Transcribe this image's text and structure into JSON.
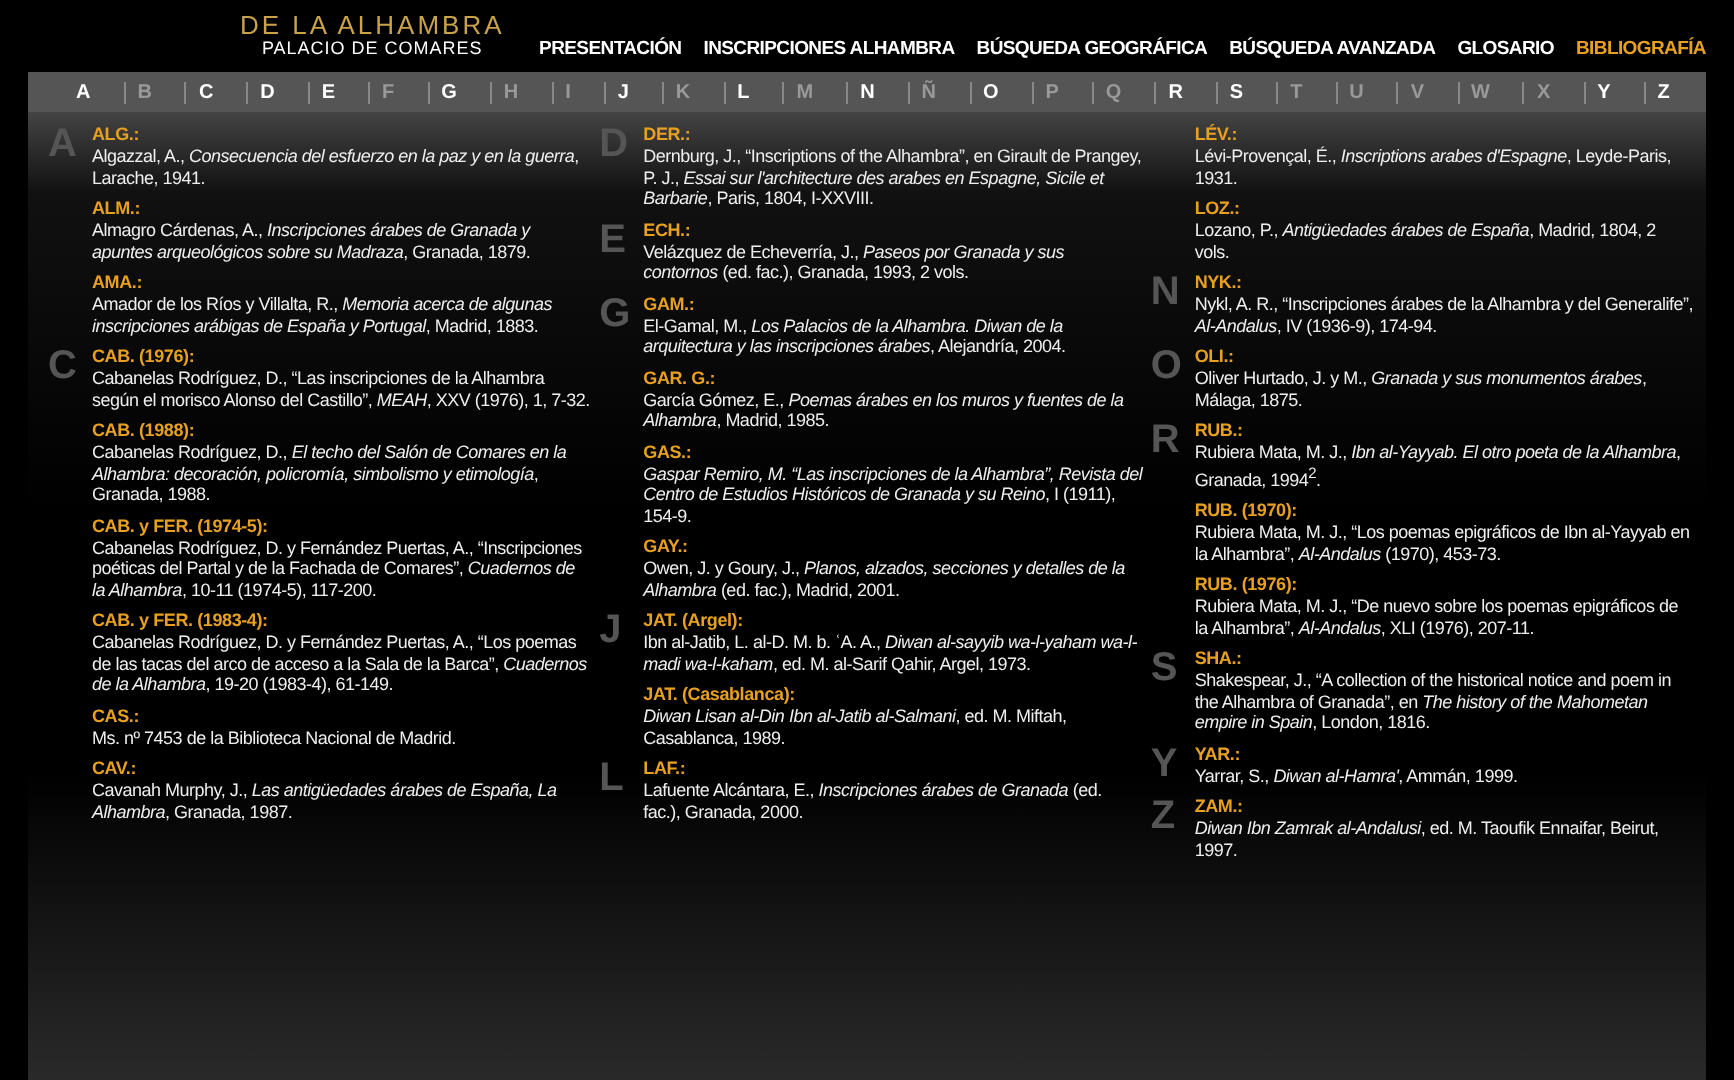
{
  "header": {
    "logo_title": "DE LA ALHAMBRA",
    "logo_subtitle": "PALACIO DE COMARES"
  },
  "nav": [
    {
      "label": "PRESENTACIÓN",
      "selected": false
    },
    {
      "label": "INSCRIPCIONES ALHAMBRA",
      "selected": false
    },
    {
      "label": "BÚSQUEDA GEOGRÁFICA",
      "selected": false
    },
    {
      "label": "BÚSQUEDA AVANZADA",
      "selected": false
    },
    {
      "label": "GLOSARIO",
      "selected": false
    },
    {
      "label": "BIBLIOGRAFÍA",
      "selected": true
    }
  ],
  "alphabet": [
    {
      "letter": "A",
      "enabled": true
    },
    {
      "letter": "B",
      "enabled": false
    },
    {
      "letter": "C",
      "enabled": true
    },
    {
      "letter": "D",
      "enabled": true
    },
    {
      "letter": "E",
      "enabled": true
    },
    {
      "letter": "F",
      "enabled": false
    },
    {
      "letter": "G",
      "enabled": true
    },
    {
      "letter": "H",
      "enabled": false
    },
    {
      "letter": "I",
      "enabled": false
    },
    {
      "letter": "J",
      "enabled": true
    },
    {
      "letter": "K",
      "enabled": false
    },
    {
      "letter": "L",
      "enabled": true
    },
    {
      "letter": "M",
      "enabled": false
    },
    {
      "letter": "N",
      "enabled": true
    },
    {
      "letter": "Ñ",
      "enabled": false
    },
    {
      "letter": "O",
      "enabled": true
    },
    {
      "letter": "P",
      "enabled": false
    },
    {
      "letter": "Q",
      "enabled": false
    },
    {
      "letter": "R",
      "enabled": true
    },
    {
      "letter": "S",
      "enabled": true
    },
    {
      "letter": "T",
      "enabled": false
    },
    {
      "letter": "U",
      "enabled": false
    },
    {
      "letter": "V",
      "enabled": false
    },
    {
      "letter": "W",
      "enabled": false
    },
    {
      "letter": "X",
      "enabled": false
    },
    {
      "letter": "Y",
      "enabled": true
    },
    {
      "letter": "Z",
      "enabled": true
    }
  ],
  "columns": [
    [
      {
        "section": "A",
        "key": "ALG.:",
        "text": "Algazzal, A., *Consecuencia del esfuerzo en la paz y en la guerra*, Larache, 1941."
      },
      {
        "key": "ALM.:",
        "text": "Almagro Cárdenas, A., *Inscripciones árabes de Granada y apuntes arqueológicos sobre su Madraza*, Granada, 1879."
      },
      {
        "key": "AMA.:",
        "text": "Amador de los Ríos y Villalta, R., *Memoria acerca de algunas inscripciones arábigas de España y Portugal*, Madrid, 1883."
      },
      {
        "section": "C",
        "key": "CAB. (1976):",
        "text": "Cabanelas Rodríguez, D., “Las inscripciones de la Alhambra según el morisco Alonso del Castillo”, *MEAH*, XXV (1976), 1, 7-32."
      },
      {
        "key": "CAB. (1988):",
        "text": "Cabanelas Rodríguez, D., *El techo del Salón de Comares en la Alhambra: decoración, policromía, simbolismo y etimología*, Granada, 1988."
      },
      {
        "key": "CAB. y FER. (1974-5):",
        "text": "Cabanelas Rodríguez, D. y Fernández Puertas, A., “Inscripciones poéticas del Partal y de la Fachada de Comares”, *Cuadernos de la Alhambra*, 10-11 (1974-5), 117-200."
      },
      {
        "key": "CAB. y FER. (1983-4):",
        "text": "Cabanelas Rodríguez, D. y Fernández Puertas, A., “Los poemas de las tacas del arco de acceso a la Sala de la Barca”, *Cuadernos de la Alhambra*, 19-20 (1983-4), 61-149."
      },
      {
        "key": "CAS.:",
        "text": "Ms. nº 7453 de la Biblioteca Nacional de Madrid."
      },
      {
        "key": "CAV.:",
        "text": "Cavanah Murphy, J., *Las antigüedades árabes de España, La Alhambra*, Granada, 1987."
      }
    ],
    [
      {
        "section": "D",
        "key": "DER.:",
        "text": "Dernburg, J., “Inscriptions of the Alhambra”, en Girault de Prangey, P. J., *Essai sur l'architecture des arabes en Espagne, Sicile et Barbarie*, Paris, 1804, I-XXVIII."
      },
      {
        "section": "E",
        "key": "ECH.:",
        "text": "Velázquez de Echeverría, J., *Paseos por Granada y sus contornos* (ed. fac.), Granada, 1993, 2 vols."
      },
      {
        "section": "G",
        "key": "GAM.:",
        "text": "El-Gamal, M., *Los Palacios de la Alhambra. Diwan de la arquitectura y las inscripciones árabes*, Alejandría, 2004."
      },
      {
        "key": "GAR. G.:",
        "text": "García Gómez, E., *Poemas árabes en los muros y fuentes de la Alhambra*, Madrid, 1985."
      },
      {
        "key": "GAS.:",
        "text": "*Gaspar Remiro, M. “Las inscripciones de la Alhambra”, Revista del Centro de Estudios Históricos de Granada y su Reino*, I (1911), 154-9."
      },
      {
        "key": "GAY.:",
        "text": "Owen, J. y Goury, J., *Planos, alzados, secciones y detalles de la Alhambra* (ed. fac.), Madrid, 2001."
      },
      {
        "section": "J",
        "key": "JAT. (Argel):",
        "text": "Ibn al-Jatib, L. al-D. M. b. ʿA. A., *Diwan al-sayyib wa-l-yaham wa-l-madi wa-l-kaham*, ed. M. al-Sarif Qahir, Argel, 1973."
      },
      {
        "key": "JAT. (Casablanca):",
        "text": "*Diwan Lisan al-Din Ibn al-Jatib al-Salmani*, ed. M. Miftah, Casablanca, 1989."
      },
      {
        "section": "L",
        "key": "LAF.:",
        "text": "Lafuente Alcántara, E., *Inscripciones árabes de Granada* (ed. fac.), Granada, 2000."
      }
    ],
    [
      {
        "key": "LÉV.:",
        "text": "Lévi-Provençal, É., *Inscriptions arabes d'Espagne*, Leyde-Paris, 1931."
      },
      {
        "key": "LOZ.:",
        "text": "Lozano, P., *Antigüedades árabes de España*, Madrid, 1804, 2 vols."
      },
      {
        "section": "N",
        "key": "NYK.:",
        "text": "Nykl, A. R., “Inscripciones árabes de la Alhambra y del Generalife”, *Al-Andalus*, IV (1936-9), 174-94."
      },
      {
        "section": "O",
        "key": "OLI.:",
        "text": "Oliver Hurtado, J. y M., *Granada y sus monumentos árabes*, Málaga, 1875."
      },
      {
        "section": "R",
        "key": "RUB.:",
        "text": "Rubiera Mata, M. J., *Ibn al-Yayyab. El otro poeta de la Alhambra*, Granada, 1994$^{2}$."
      },
      {
        "key": "RUB. (1970):",
        "text": "Rubiera Mata, M. J., “Los poemas epigráficos de Ibn al-Yayyab en la Alhambra”, *Al-Andalus* (1970), 453-73."
      },
      {
        "key": "RUB. (1976):",
        "text": "Rubiera Mata, M. J., “De nuevo sobre los poemas epigráficos de la Alhambra”, *Al-Andalus*, XLI (1976), 207-11."
      },
      {
        "section": "S",
        "key": "SHA.:",
        "text": "Shakespear, J., “A collection of the historical notice and poem in the Alhambra of Granada”, en *The history of the Mahometan empire in Spain*, London, 1816."
      },
      {
        "section": "Y",
        "key": "YAR.:",
        "text": "Yarrar, S., *Diwan al-Hamra'*, Ammán, 1999."
      },
      {
        "section": "Z",
        "key": "ZAM.:",
        "text": "*Diwan Ibn Zamrak al-Andalusi*, ed. M. Taoufik Ennaifar, Beirut, 1997."
      }
    ]
  ]
}
